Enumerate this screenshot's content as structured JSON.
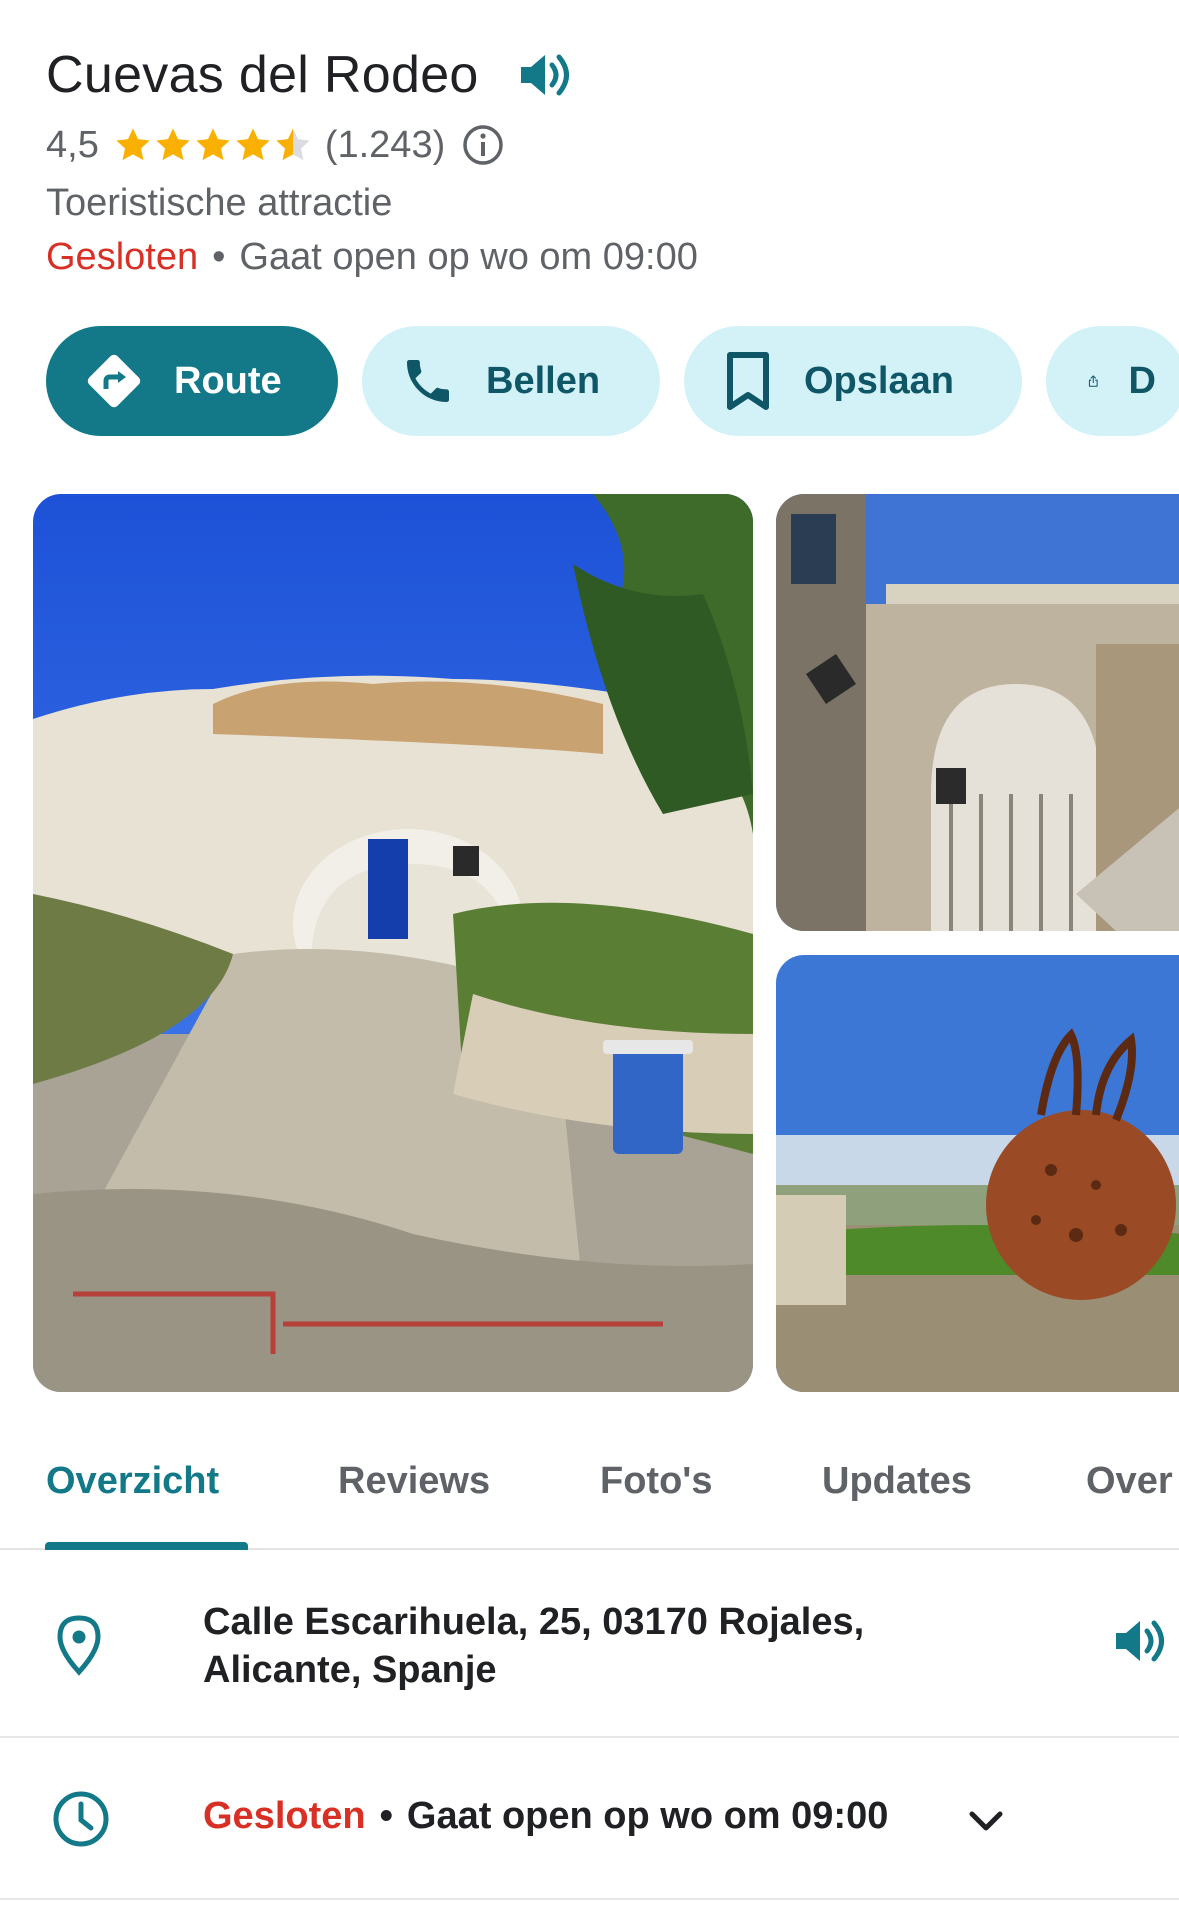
{
  "place": {
    "name": "Cuevas del Rodeo",
    "rating": "4,5",
    "rating_stars": 4.5,
    "review_count": "(1.243)",
    "category": "Toeristische attractie",
    "status_closed": "Gesloten",
    "status_separator": "•",
    "status_open_info": "Gaat open op wo om 09:00"
  },
  "actions": {
    "route_label": "Route",
    "call_label": "Bellen",
    "save_label": "Opslaan",
    "share_label": "D"
  },
  "tabs": [
    {
      "label": "Overzicht"
    },
    {
      "label": "Reviews"
    },
    {
      "label": "Foto's"
    },
    {
      "label": "Updates"
    },
    {
      "label": "Over"
    }
  ],
  "details": {
    "address_line1": "Calle Escarihuela, 25, 03170 Rojales,",
    "address_line2": "Alicante, Spanje",
    "hours_closed": "Gesloten",
    "hours_separator": "•",
    "hours_info": "Gaat open op wo om 09:00"
  },
  "colors": {
    "accent": "#137989",
    "accent_light": "#d3f2f8",
    "closed": "#d93025",
    "star": "#f9b000"
  },
  "icons": [
    "speaker-icon",
    "star-icon",
    "info-icon",
    "directions-icon",
    "phone-icon",
    "bookmark-icon",
    "share-icon",
    "location-pin-icon",
    "clock-icon",
    "chevron-down-icon"
  ]
}
